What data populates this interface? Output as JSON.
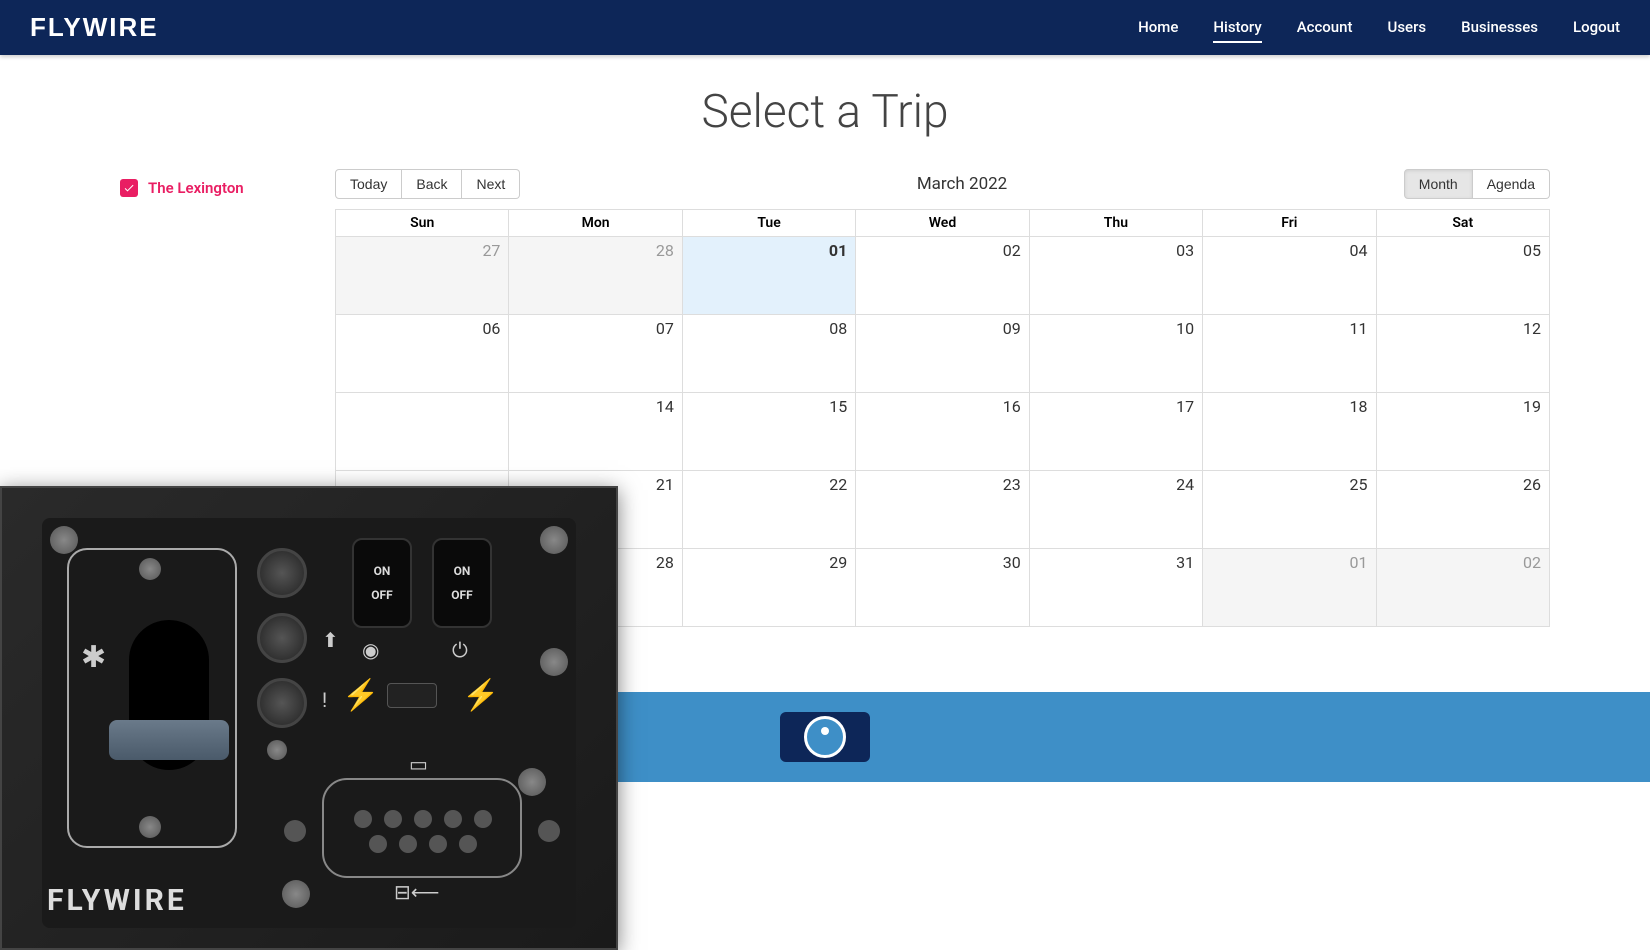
{
  "header": {
    "logo": "FLYWIRE",
    "nav": [
      "Home",
      "History",
      "Account",
      "Users",
      "Businesses",
      "Logout"
    ],
    "nav_active_index": 1
  },
  "page": {
    "title": "Select a Trip"
  },
  "sidebar": {
    "filters": [
      {
        "label": "The Lexington",
        "checked": true
      }
    ]
  },
  "calendar": {
    "month_label": "March 2022",
    "nav_buttons": [
      "Today",
      "Back",
      "Next"
    ],
    "view_buttons": [
      "Month",
      "Agenda"
    ],
    "view_active_index": 0,
    "day_headers": [
      "Sun",
      "Mon",
      "Tue",
      "Wed",
      "Thu",
      "Fri",
      "Sat"
    ],
    "weeks": [
      [
        {
          "day": "27",
          "other": true
        },
        {
          "day": "28",
          "other": true
        },
        {
          "day": "01",
          "today": true
        },
        {
          "day": "02"
        },
        {
          "day": "03"
        },
        {
          "day": "04"
        },
        {
          "day": "05"
        }
      ],
      [
        {
          "day": "06"
        },
        {
          "day": "07"
        },
        {
          "day": "08"
        },
        {
          "day": "09"
        },
        {
          "day": "10"
        },
        {
          "day": "11"
        },
        {
          "day": "12"
        }
      ],
      [
        {
          "day": "14"
        },
        {
          "day": "15"
        },
        {
          "day": "16"
        },
        {
          "day": "17"
        },
        {
          "day": "18"
        },
        {
          "day": "19"
        }
      ],
      [
        {
          "day": "21"
        },
        {
          "day": "22"
        },
        {
          "day": "23"
        },
        {
          "day": "24"
        },
        {
          "day": "25"
        },
        {
          "day": "26"
        }
      ],
      [
        {
          "day": "28"
        },
        {
          "day": "29"
        },
        {
          "day": "30"
        },
        {
          "day": "31"
        },
        {
          "day": "01",
          "other": true
        },
        {
          "day": "02",
          "other": true
        }
      ]
    ]
  },
  "device": {
    "logo": "FLYWIRE",
    "switch1": {
      "on": "ON",
      "off": "OFF"
    },
    "switch2": {
      "on": "ON",
      "off": "OFF"
    }
  }
}
